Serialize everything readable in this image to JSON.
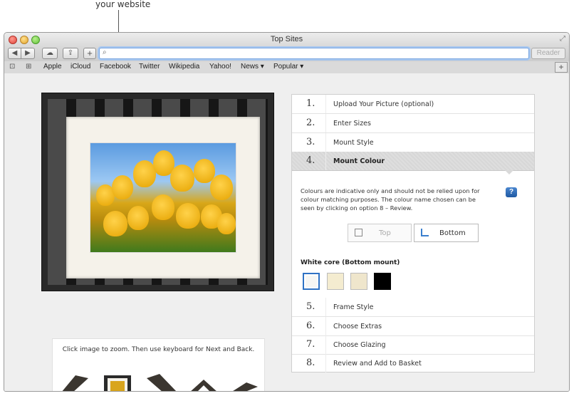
{
  "callout": {
    "text": "your website"
  },
  "window": {
    "title": "Top Sites",
    "toolbar": {
      "back_icon": "◀",
      "forward_icon": "▶",
      "cloud_icon": "☁",
      "share_icon": "⇪",
      "add_icon": "+",
      "search_icon": "⌕",
      "url_value": "",
      "reader_label": "Reader"
    },
    "bookmarks": {
      "reading_list_icon": "⊡",
      "top_sites_icon": "⊞",
      "items": [
        "Apple",
        "iCloud",
        "Facebook",
        "Twitter",
        "Wikipedia",
        "Yahoo!",
        "News ▾",
        "Popular ▾"
      ],
      "new_tab": "+"
    }
  },
  "zoom_hint": {
    "text": "Click image to zoom. Then use keyboard for Next and Back."
  },
  "steps": [
    {
      "num": "1.",
      "label": "Upload Your Picture (optional)"
    },
    {
      "num": "2.",
      "label": "Enter Sizes"
    },
    {
      "num": "3.",
      "label": "Mount Style"
    },
    {
      "num": "4.",
      "label": "Mount Colour"
    },
    {
      "num": "5.",
      "label": "Frame Style"
    },
    {
      "num": "6.",
      "label": "Choose Extras"
    },
    {
      "num": "7.",
      "label": "Choose Glazing"
    },
    {
      "num": "8.",
      "label": "Review and Add to Basket"
    }
  ],
  "mount_colour": {
    "note": "Colours are indicative only and should not be relied upon for colour matching purposes. The colour name chosen can be seen by clicking on option 8 – Review.",
    "help": "?",
    "top_label": "Top",
    "bottom_label": "Bottom",
    "core_label": "White core (Bottom mount)",
    "swatches": [
      "#f6f6f4",
      "#f4ecd0",
      "#efe6cc",
      "#000000"
    ]
  }
}
